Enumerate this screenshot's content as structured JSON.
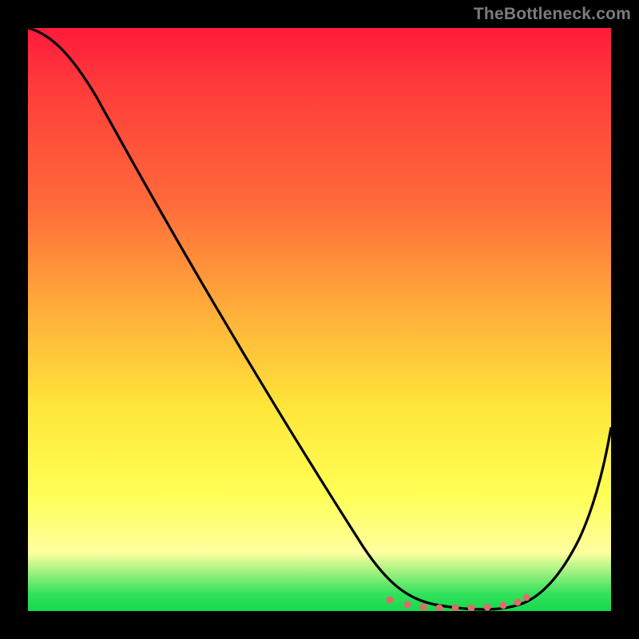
{
  "watermark": "TheBottleneck.com",
  "chart_data": {
    "type": "line",
    "title": "",
    "xlabel": "",
    "ylabel": "",
    "xlim": [
      0,
      100
    ],
    "ylim": [
      0,
      100
    ],
    "grid": false,
    "series": [
      {
        "name": "curve",
        "x": [
          0,
          3,
          8,
          14,
          20,
          28,
          36,
          44,
          52,
          58,
          62,
          66,
          70,
          74,
          78,
          82,
          85,
          88,
          92,
          96,
          100
        ],
        "y": [
          100,
          99,
          97,
          93,
          86,
          76,
          65,
          53,
          41,
          31,
          24,
          17,
          10,
          4,
          1,
          0,
          0,
          2,
          8,
          18,
          32
        ]
      },
      {
        "name": "flat-dots",
        "x": [
          62,
          66,
          70,
          73,
          76,
          79,
          82,
          84
        ],
        "y": [
          1,
          1,
          1,
          1,
          1,
          1,
          1,
          2
        ]
      }
    ],
    "colors": {
      "curve": "#000000",
      "dots": "#e06a6a",
      "bg_top": "#ff1a3c",
      "bg_mid": "#ffe63a",
      "bg_bot": "#17d84e"
    }
  }
}
